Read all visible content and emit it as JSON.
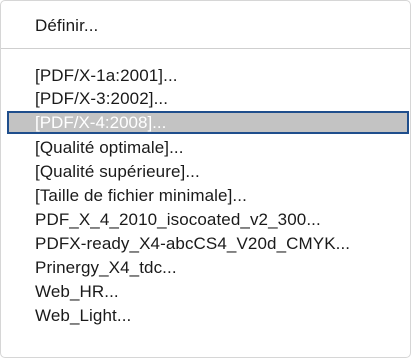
{
  "menu": {
    "top_item": "Définir...",
    "presets": [
      "[PDF/X-1a:2001]...",
      "[PDF/X-3:2002]...",
      "[PDF/X-4:2008]...",
      "[Qualité optimale]...",
      "[Qualité supérieure]...",
      "[Taille de fichier minimale]...",
      "PDF_X_4_2010_isocoated_v2_300...",
      "PDFX-ready_X4-abcCS4_V20d_CMYK...",
      "Prinergy_X4_tdc...",
      "Web_HR...",
      "Web_Light..."
    ],
    "selected_index": 2
  },
  "colors": {
    "highlight_bg": "#c3c3c3",
    "highlight_border": "#1f4e8c",
    "highlight_text": "#ffffff",
    "text": "#1a1a1a"
  }
}
